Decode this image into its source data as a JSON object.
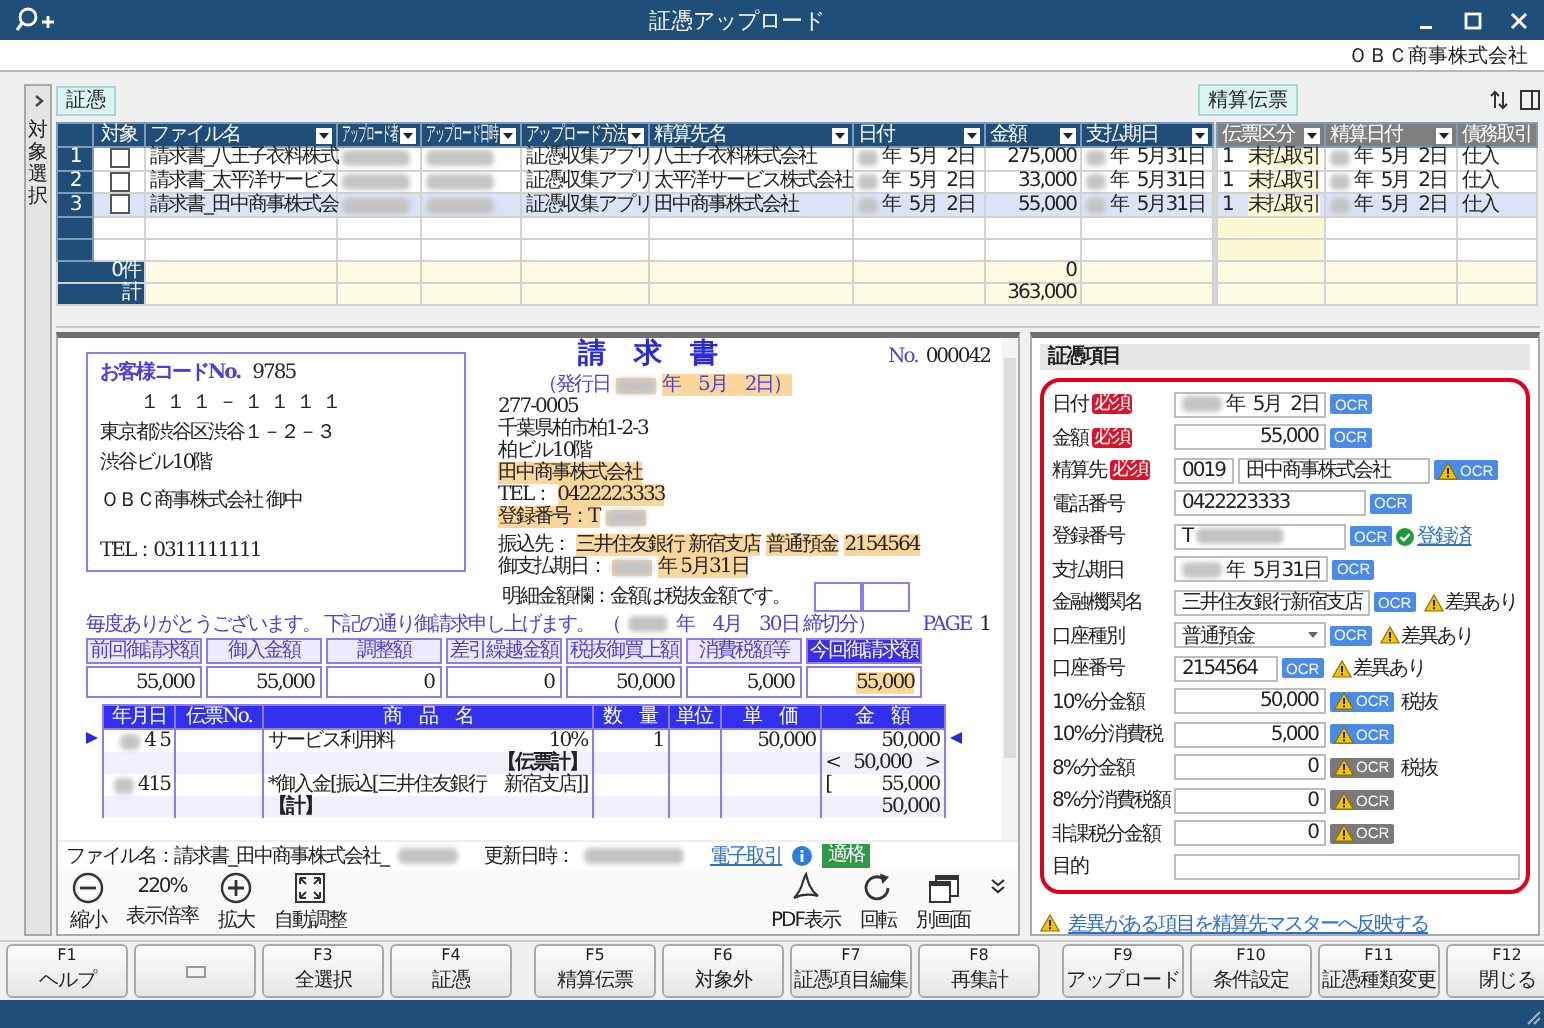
{
  "window": {
    "title": "証憑アップロード"
  },
  "company": "ＯＢＣ商事株式会社",
  "side_tab": {
    "label": "対象選択"
  },
  "voucher_tag": "証憑",
  "settlement_button": "精算伝票",
  "table": {
    "columns": [
      {
        "label": "対象",
        "kind": "check",
        "filter": false
      },
      {
        "label": "ファイル名",
        "kind": "text",
        "filter": true
      },
      {
        "label": "アップロード者",
        "kind": "text",
        "filter": true
      },
      {
        "label": "アップロード日時",
        "kind": "text",
        "filter": true
      },
      {
        "label": "アップロード方法",
        "kind": "text",
        "filter": true
      },
      {
        "label": "精算先名",
        "kind": "text",
        "filter": true
      },
      {
        "label": "日付",
        "kind": "text",
        "filter": true
      },
      {
        "label": "金額",
        "kind": "amount",
        "filter": true
      },
      {
        "label": "支払期日",
        "kind": "text",
        "filter": true
      },
      {
        "label": "伝票区分",
        "kind": "slip",
        "filter": true
      },
      {
        "label": "精算日付",
        "kind": "slip",
        "filter": true
      },
      {
        "label": "債務取引",
        "kind": "slip",
        "filter": false
      }
    ],
    "rows": [
      {
        "number": "1",
        "selected": false,
        "cells": [
          {
            "checked": false
          },
          {
            "text": "請求書_八王子衣料株式"
          },
          {
            "redacted": true
          },
          {
            "redacted": true
          },
          {
            "text": "証憑収集アプリ"
          },
          {
            "text": "八王子衣料株式会社"
          },
          {
            "text": "年  5月  2日",
            "redacted": true
          },
          {
            "text": "275,000"
          },
          {
            "text": "年  5月31日",
            "redacted": true
          },
          {
            "code": "1",
            "text": "未払取引"
          },
          {
            "text": "年  5月  2日",
            "redacted": true
          },
          {
            "text": "仕入"
          }
        ]
      },
      {
        "number": "2",
        "selected": false,
        "cells": [
          {
            "checked": false
          },
          {
            "text": "請求書_太平洋サービス"
          },
          {
            "redacted": true
          },
          {
            "redacted": true
          },
          {
            "text": "証憑収集アプリ"
          },
          {
            "text": "太平洋サービス株式会社"
          },
          {
            "text": "年  5月  2日",
            "redacted": true
          },
          {
            "text": "33,000"
          },
          {
            "text": "年  5月31日",
            "redacted": true
          },
          {
            "code": "1",
            "text": "未払取引"
          },
          {
            "text": "年  5月  2日",
            "redacted": true
          },
          {
            "text": "仕入"
          }
        ]
      },
      {
        "number": "3",
        "selected": true,
        "cells": [
          {
            "checked": false
          },
          {
            "text": "請求書_田中商事株式会"
          },
          {
            "redacted": true
          },
          {
            "redacted": true
          },
          {
            "text": "証憑収集アプリ"
          },
          {
            "text": "田中商事株式会社"
          },
          {
            "text": "年  5月  2日",
            "redacted": true
          },
          {
            "text": "55,000"
          },
          {
            "text": "年  5月31日",
            "redacted": true
          },
          {
            "code": "1",
            "text": "未払取引"
          },
          {
            "text": "年  5月  2日",
            "redacted": true
          },
          {
            "text": "仕入"
          }
        ]
      }
    ],
    "summary": [
      {
        "label": "0件",
        "amount": "0"
      },
      {
        "label": "計",
        "amount": "363,000"
      }
    ]
  },
  "document": {
    "customer_code_label": "お客様コードNo.",
    "customer_code": "9785",
    "recipient_lines": [
      "１１１－１１１１",
      "東京都渋谷区渋谷１－２－３",
      "渋谷ビル10階",
      "ＯＢＣ商事株式会社 御中",
      "TEL：0311111111"
    ],
    "title": "請　求　書",
    "number_label": "No.",
    "number": "000042",
    "issuer_lines": [
      [
        {
          "text": "（発行日",
          "kind": "label",
          "highlighted": false
        },
        {
          "redacted": true,
          "highlighted": true
        },
        {
          "text": "年　5月　2日）",
          "kind": "label",
          "highlighted": true
        }
      ],
      [
        {
          "text": "277-0005",
          "highlighted": false
        }
      ],
      [
        {
          "text": "千葉県柏市柏1-2-3",
          "highlighted": false
        }
      ],
      [
        {
          "text": "柏ビル10階",
          "highlighted": false
        }
      ],
      [
        {
          "text": "田中商事株式会社",
          "highlighted": true
        }
      ],
      [
        {
          "text": "TEL：",
          "highlighted": false
        },
        {
          "text": "0422223333",
          "highlighted": true
        }
      ],
      [
        {
          "text": "登録番号：T",
          "highlighted": true
        },
        {
          "redacted": true,
          "highlighted": true
        }
      ],
      [
        {
          "text": "振込先：",
          "highlighted": false
        },
        {
          "text": "三井住友銀行 新宿支店",
          "highlighted": true
        },
        {
          "text": "普通預金",
          "highlighted": true
        },
        {
          "text": "2154564",
          "highlighted": true
        }
      ],
      [
        {
          "text": "御支払期日：",
          "highlighted": false
        },
        {
          "redacted": true,
          "highlighted": true
        },
        {
          "text": "年 5月31日",
          "highlighted": true
        }
      ]
    ],
    "note": "明細金額欄：金額は税抜金額です。",
    "greeting": "毎度ありがとうございます。 下記の通り御請求申し上げます。",
    "period": [
      {
        "text": "（",
        "kind": "label",
        "highlighted": false
      },
      {
        "redacted": true,
        "highlighted": false
      },
      {
        "text": "年　4月　30日 締切分）",
        "kind": "label",
        "highlighted": false
      }
    ],
    "page_label": "PAGE",
    "page": "1",
    "summary": [
      {
        "label": "前回御請求額",
        "value": "55,000",
        "highlighted": false
      },
      {
        "label": "御入金額",
        "value": "55,000",
        "highlighted": false
      },
      {
        "label": "調整額",
        "value": "0",
        "highlighted": false
      },
      {
        "label": "差引繰越金額",
        "value": "0",
        "highlighted": false
      },
      {
        "label": "税抜御買上額",
        "value": "50,000",
        "highlighted": false
      },
      {
        "label": "消費税額等",
        "value": "5,000",
        "highlighted": false
      },
      {
        "label": "今回御請求額",
        "value": "55,000",
        "highlighted": true
      }
    ],
    "detail_columns": [
      "年月日",
      "伝票No.",
      "商　品　名",
      "数　量",
      "単位",
      "単　価",
      "金　額"
    ],
    "detail_rows": [
      {
        "kind": "line",
        "date": "4 5",
        "redacted": true,
        "item": "サービス利用料",
        "rate": "10%",
        "qty": "1",
        "price": "50,000",
        "amount": "50,000"
      },
      {
        "kind": "subtotal",
        "item": "【伝票計】",
        "open": "<",
        "amount": "50,000",
        "close": ">"
      },
      {
        "kind": "payment",
        "date": "415",
        "redacted": true,
        "item": "*御入金[振込[三井住友銀行　新宿支店]]",
        "open": "[",
        "amount": "55,000"
      },
      {
        "kind": "total",
        "item": "【計】",
        "amount": "50,000"
      }
    ]
  },
  "file_info": {
    "file_label": "ファイル名：請求書_田中商事株式会社_",
    "updated_label": "更新日時：",
    "link": "電子取引",
    "badge": "適格"
  },
  "viewer_tools": [
    {
      "kind": "zoom_out",
      "label": "縮小"
    },
    {
      "kind": "zoom_level",
      "value": "220%",
      "label": "表示倍率"
    },
    {
      "kind": "zoom_in",
      "label": "拡大"
    },
    {
      "kind": "fit",
      "label": "自動調整"
    },
    {
      "kind": "pdf",
      "label": "PDF表示"
    },
    {
      "kind": "rotate",
      "label": "回転"
    },
    {
      "kind": "window",
      "label": "別画面"
    }
  ],
  "voucher_items": {
    "title": "証憑項目",
    "fields": [
      {
        "label": "日付",
        "badge": "必須",
        "kind": "date",
        "value": "年  5月  2日",
        "redacted": true,
        "ocr": {
          "text": "OCR",
          "warning": false,
          "disabled": false
        }
      },
      {
        "label": "金額",
        "badge": "必須",
        "kind": "amount",
        "value": "55,000",
        "ocr": {
          "text": "OCR",
          "warning": false,
          "disabled": false
        }
      },
      {
        "label": "精算先",
        "badge": "必須",
        "kind": "partner",
        "code": "0019",
        "value": "田中商事株式会社",
        "ocr": {
          "text": "OCR",
          "warning": true,
          "disabled": false
        }
      },
      {
        "label": "電話番号",
        "kind": "text",
        "value": "0422223333",
        "ocr": {
          "text": "OCR",
          "warning": false,
          "disabled": false
        }
      },
      {
        "label": "登録番号",
        "kind": "registration",
        "value": "T",
        "redacted": true,
        "ocr": {
          "text": "OCR",
          "warning": false,
          "disabled": false
        },
        "status": "登録済"
      },
      {
        "label": "支払期日",
        "kind": "date",
        "value": "年  5月31日",
        "redacted": true,
        "ocr": {
          "text": "OCR",
          "warning": false,
          "disabled": false
        }
      },
      {
        "label": "金融機関名",
        "kind": "text",
        "value": "三井住友銀行新宿支店",
        "ocr": {
          "text": "OCR",
          "warning": false,
          "disabled": false
        },
        "note": {
          "text": "差異あり",
          "warning": true
        }
      },
      {
        "label": "口座種別",
        "kind": "select",
        "value": "普通預金",
        "ocr": {
          "text": "OCR",
          "warning": false,
          "disabled": false
        },
        "note": {
          "text": "差異あり",
          "warning": true
        }
      },
      {
        "label": "口座番号",
        "kind": "code",
        "value": "2154564",
        "ocr": {
          "text": "OCR",
          "warning": false,
          "disabled": false
        },
        "note": {
          "text": "差異あり",
          "warning": true
        }
      },
      {
        "label": "10%分金額",
        "kind": "amount",
        "value": "50,000",
        "ocr": {
          "text": "OCR",
          "warning": true,
          "disabled": false
        },
        "note": {
          "text": "税抜",
          "warning": false
        }
      },
      {
        "label": "10%分消費税",
        "kind": "amount",
        "value": "5,000",
        "ocr": {
          "text": "OCR",
          "warning": true,
          "disabled": false
        }
      },
      {
        "label": "8%分金額",
        "kind": "amount",
        "value": "0",
        "ocr": {
          "text": "OCR",
          "warning": true,
          "disabled": true
        },
        "note": {
          "text": "税抜",
          "warning": false
        }
      },
      {
        "label": "8%分消費税額",
        "kind": "amount",
        "value": "0",
        "ocr": {
          "text": "OCR",
          "warning": true,
          "disabled": true
        }
      },
      {
        "label": "非課税分金額",
        "kind": "amount",
        "value": "0",
        "ocr": {
          "text": "OCR",
          "warning": true,
          "disabled": true
        }
      },
      {
        "label": "目的",
        "kind": "memo"
      }
    ],
    "link": "差異がある項目を精算先マスターへ反映する"
  },
  "function_keys": [
    {
      "kind": "key",
      "key": "F1",
      "label": "ヘルプ"
    },
    {
      "kind": "blank"
    },
    {
      "kind": "key",
      "key": "F3",
      "label": "全選択"
    },
    {
      "kind": "key",
      "key": "F4",
      "label": "証憑"
    },
    {
      "kind": "key",
      "key": "F5",
      "label": "精算伝票"
    },
    {
      "kind": "key",
      "key": "F6",
      "label": "対象外"
    },
    {
      "kind": "key",
      "key": "F7",
      "label": "証憑項目編集"
    },
    {
      "kind": "key",
      "key": "F8",
      "label": "再集計"
    },
    {
      "kind": "key",
      "key": "F9",
      "label": "アップロード"
    },
    {
      "kind": "key",
      "key": "F10",
      "label": "条件設定"
    },
    {
      "kind": "key",
      "key": "F11",
      "label": "証憑種類変更"
    },
    {
      "kind": "key",
      "key": "F12",
      "label": "閉じる"
    }
  ]
}
